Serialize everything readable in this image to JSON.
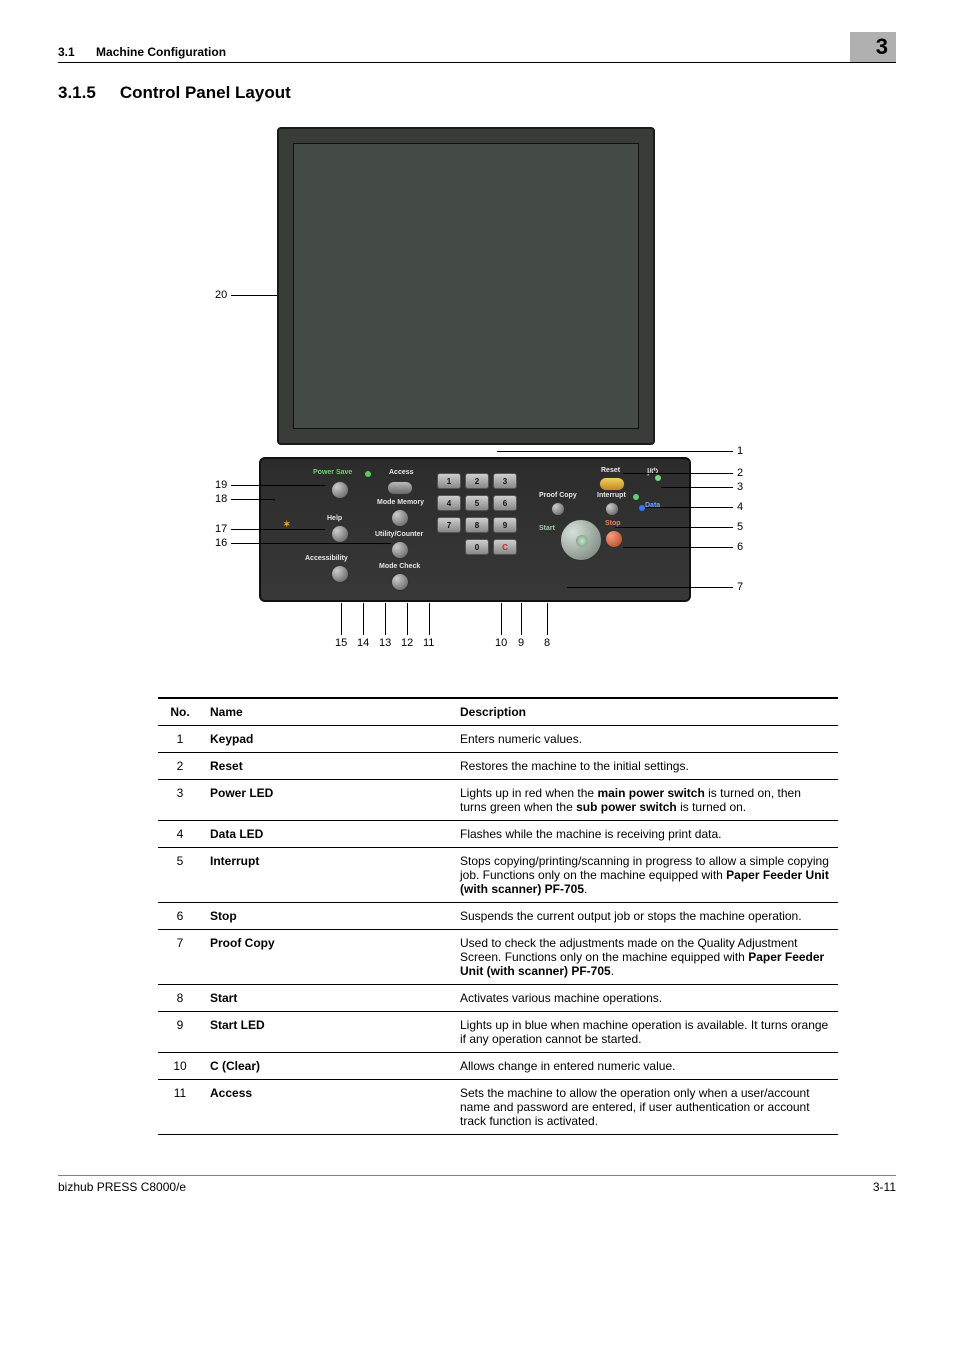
{
  "header": {
    "section_no": "3.1",
    "section_title": "Machine Configuration",
    "chapter_no": "3"
  },
  "heading": {
    "number": "3.1.5",
    "title": "Control Panel Layout"
  },
  "figure": {
    "keypad_keys": [
      "1",
      "2",
      "3",
      "4",
      "5",
      "6",
      "7",
      "8",
      "9",
      "0",
      "C"
    ],
    "panel_labels": {
      "power_save": "Power Save",
      "access": "Access",
      "reset": "Reset",
      "mode_memory": "Mode Memory",
      "proof_copy": "Proof Copy",
      "interrupt": "Interrupt",
      "data": "Data",
      "help": "Help",
      "utility_counter": "Utility/Counter",
      "stop": "Stop",
      "start": "Start",
      "accessibility": "Accessibility",
      "mode_check": "Mode Check"
    },
    "callouts_right": [
      "1",
      "2",
      "3",
      "4",
      "5",
      "6",
      "7"
    ],
    "callouts_left": [
      "20",
      "19",
      "18",
      "17",
      "16"
    ],
    "callouts_bottom": [
      "15",
      "14",
      "13",
      "12",
      "11",
      "10",
      "9",
      "8"
    ]
  },
  "table": {
    "head": {
      "no": "No.",
      "name": "Name",
      "desc": "Description"
    },
    "rows": [
      {
        "no": "1",
        "name": "Keypad",
        "desc_plain": "Enters numeric values."
      },
      {
        "no": "2",
        "name": "Reset",
        "desc_plain": "Restores the machine to the initial settings."
      },
      {
        "no": "3",
        "name": "Power LED",
        "desc_html": "Lights up in red when the <span class='b'>main power switch</span> is turned on, then turns green when the <span class='b'>sub power switch</span> is turned on."
      },
      {
        "no": "4",
        "name": "Data LED",
        "desc_plain": "Flashes while the machine is receiving print data."
      },
      {
        "no": "5",
        "name": "Interrupt",
        "desc_html": "Stops copying/printing/scanning in progress to allow a simple copying job. Functions only on the machine equipped with <span class='b'>Paper Feeder Unit (with scanner) PF-705</span>."
      },
      {
        "no": "6",
        "name": "Stop",
        "desc_plain": "Suspends the current output job or stops the machine operation."
      },
      {
        "no": "7",
        "name": "Proof Copy",
        "desc_html": "Used to check the adjustments made on the Quality Adjustment Screen. Functions only on the machine equipped with <span class='b'>Paper Feeder Unit (with scanner) PF-705</span>."
      },
      {
        "no": "8",
        "name": "Start",
        "desc_plain": "Activates various machine operations."
      },
      {
        "no": "9",
        "name": "Start LED",
        "desc_plain": "Lights up in blue when machine operation is available. It turns orange if any operation cannot be started."
      },
      {
        "no": "10",
        "name": "C (Clear)",
        "desc_plain": "Allows change in entered numeric value."
      },
      {
        "no": "11",
        "name": "Access",
        "desc_plain": "Sets the machine to allow the operation only when a user/account name and password are entered, if user authentication or account track function is activated."
      }
    ]
  },
  "footer": {
    "left": "bizhub PRESS C8000/e",
    "right": "3-11"
  }
}
